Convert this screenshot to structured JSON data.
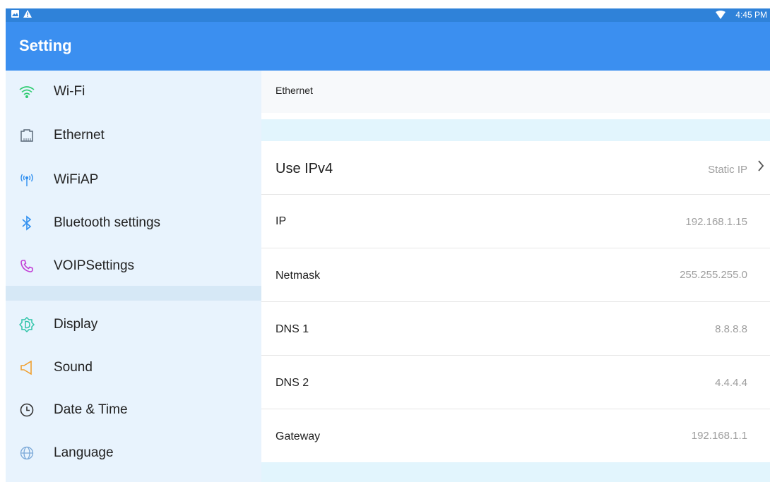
{
  "statusbar": {
    "time": "4:45 PM"
  },
  "appbar": {
    "title": "Setting"
  },
  "sidebar": {
    "items": [
      {
        "label": "Wi-Fi"
      },
      {
        "label": "Ethernet"
      },
      {
        "label": "WiFiAP"
      },
      {
        "label": "Bluetooth settings"
      },
      {
        "label": "VOIPSettings"
      },
      {
        "label": "Display"
      },
      {
        "label": "Sound"
      },
      {
        "label": "Date & Time"
      },
      {
        "label": "Language"
      }
    ]
  },
  "main": {
    "breadcrumb": "Ethernet",
    "ipv4": {
      "label": "Use IPv4",
      "value": "Static IP"
    },
    "fields": [
      {
        "label": "IP",
        "value": "192.168.1.15"
      },
      {
        "label": "Netmask",
        "value": "255.255.255.0"
      },
      {
        "label": "DNS 1",
        "value": "8.8.8.8"
      },
      {
        "label": "DNS 2",
        "value": "4.4.4.4"
      },
      {
        "label": "Gateway",
        "value": "192.168.1.1"
      }
    ]
  },
  "icons": {
    "wifi": "wifi-icon",
    "ethernet": "ethernet-icon",
    "wifiap": "hotspot-icon",
    "bluetooth": "bluetooth-icon",
    "voip": "phone-icon",
    "display": "display-icon",
    "sound": "speaker-icon",
    "datetime": "clock-icon",
    "language": "globe-icon"
  },
  "colors": {
    "appbar": "#3b8ff0",
    "statusbar": "#2f82d9",
    "sidebar": "#e8f3fd",
    "band": "#e2f5fd",
    "wifi": "#2ecc71",
    "voip": "#c23fd6",
    "sound": "#f0a030",
    "blue": "#2f8ff0"
  }
}
